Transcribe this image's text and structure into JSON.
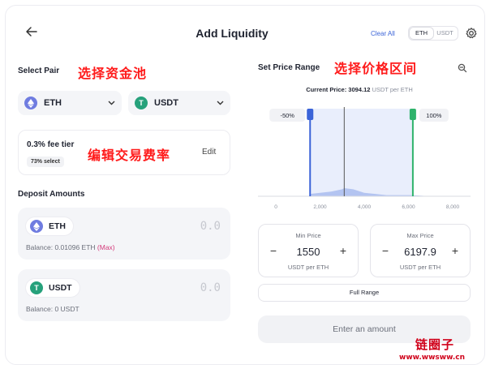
{
  "header": {
    "title": "Add Liquidity",
    "clear_all": "Clear All",
    "toggle": [
      "ETH",
      "USDT"
    ],
    "toggle_active": "ETH"
  },
  "left": {
    "select_pair_label": "Select Pair",
    "select_pair_annotation": "选择资金池",
    "token_a": {
      "symbol": "ETH",
      "icon": "eth-icon"
    },
    "token_b": {
      "symbol": "USDT",
      "icon": "usdt-icon"
    },
    "fee": {
      "title": "0.3% fee tier",
      "badge": "73% select",
      "edit": "Edit",
      "annotation": "编辑交易费率"
    },
    "deposit_label": "Deposit Amounts",
    "deposits": [
      {
        "symbol": "ETH",
        "amount": "0.0",
        "balance_prefix": "Balance: 0.01096 ETH",
        "max": "(Max)"
      },
      {
        "symbol": "USDT",
        "amount": "0.0",
        "balance_prefix": "Balance: 0 USDT",
        "max": ""
      }
    ]
  },
  "right": {
    "range_label": "Set Price Range",
    "range_annotation": "选择价格区间",
    "current_price_label": "Current Price:",
    "current_price_value": "3094.12",
    "current_price_unit": "USDT per ETH",
    "min": {
      "label": "Min Price",
      "value": "1550",
      "unit": "USDT per ETH"
    },
    "max": {
      "label": "Max Price",
      "value": "6197.9",
      "unit": "USDT per ETH"
    },
    "full_range": "Full Range",
    "enter_amount": "Enter an amount"
  },
  "chart_data": {
    "type": "area",
    "x_ticks": [
      "0",
      "2,000",
      "4,000",
      "6,000",
      "8,000"
    ],
    "xlim": [
      0,
      8000
    ],
    "current_price": 3094.12,
    "range_min": 1550,
    "range_max": 6197.9,
    "min_tag": "-50%",
    "max_tag": "100%",
    "liquidity": {
      "x": [
        0,
        1500,
        1550,
        2000,
        2500,
        3000,
        3094,
        3500,
        4000,
        4500,
        5000,
        6000,
        6200,
        7000,
        8000
      ],
      "y": [
        0,
        0,
        2,
        3,
        4,
        6,
        7,
        6,
        3,
        2,
        1,
        1,
        1,
        0,
        0
      ]
    },
    "colors": {
      "min_handle": "#3b64d8",
      "max_handle": "#2fb36b",
      "range_fill": "#e9eefc",
      "current_line": "#555555"
    }
  },
  "watermark": {
    "title": "链圈子",
    "url": "www.wwsww.cn"
  }
}
